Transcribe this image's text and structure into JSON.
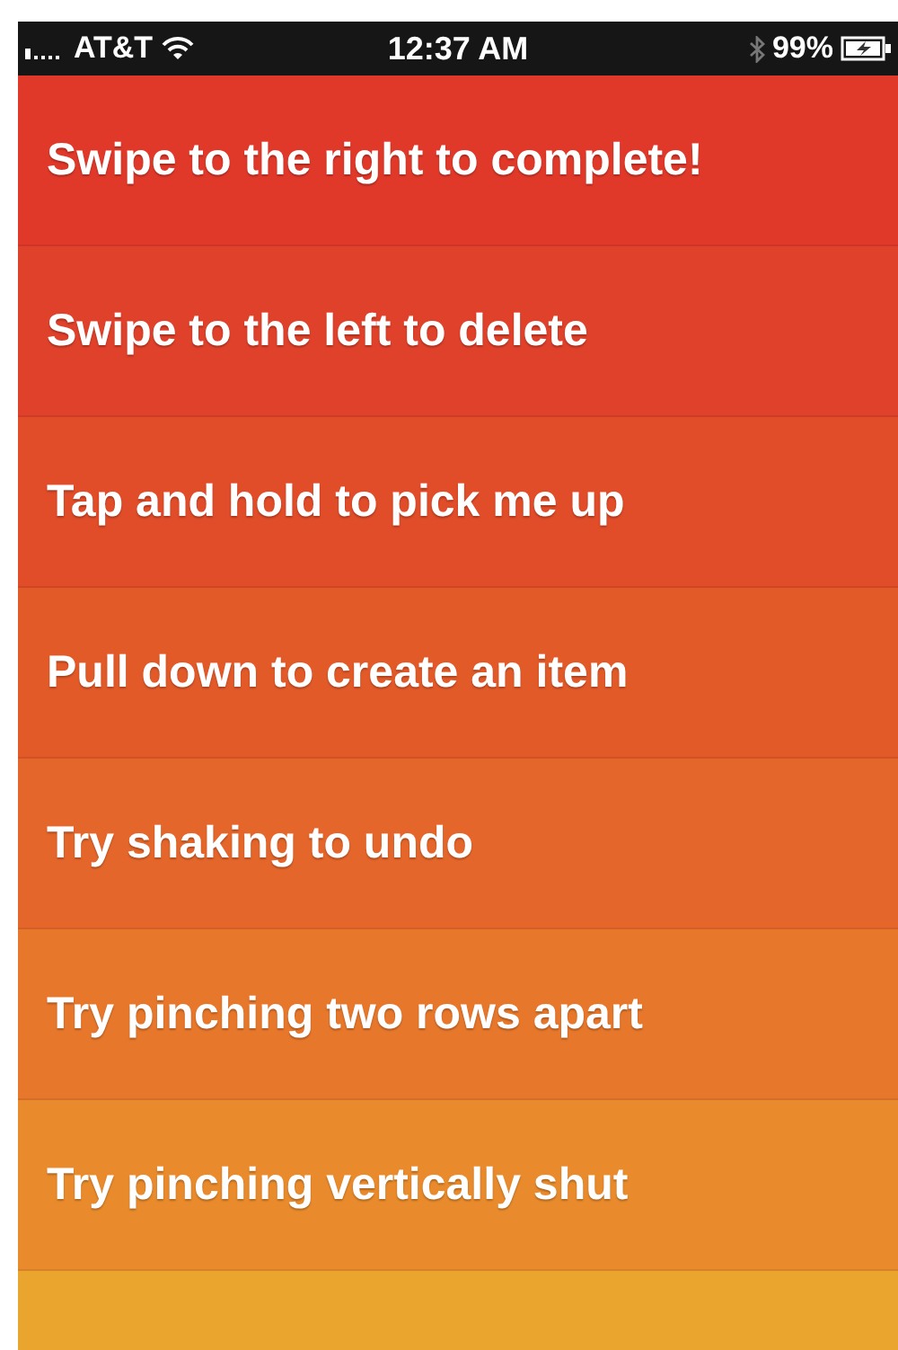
{
  "status_bar": {
    "carrier": "AT&T",
    "time": "12:37 AM",
    "battery": "99%"
  },
  "items": [
    {
      "text": "Swipe to the right to complete!",
      "color": "#e0392a"
    },
    {
      "text": "Swipe to the left to delete",
      "color": "#e0412a"
    },
    {
      "text": "Tap and hold to pick me up",
      "color": "#e14c29"
    },
    {
      "text": "Pull down to create an item",
      "color": "#e35a29"
    },
    {
      "text": "Try shaking to undo",
      "color": "#e5662a"
    },
    {
      "text": "Try pinching two rows apart",
      "color": "#e7772b"
    },
    {
      "text": "Try pinching vertically shut",
      "color": "#e98b2c"
    },
    {
      "color": "#eaa52f"
    }
  ]
}
